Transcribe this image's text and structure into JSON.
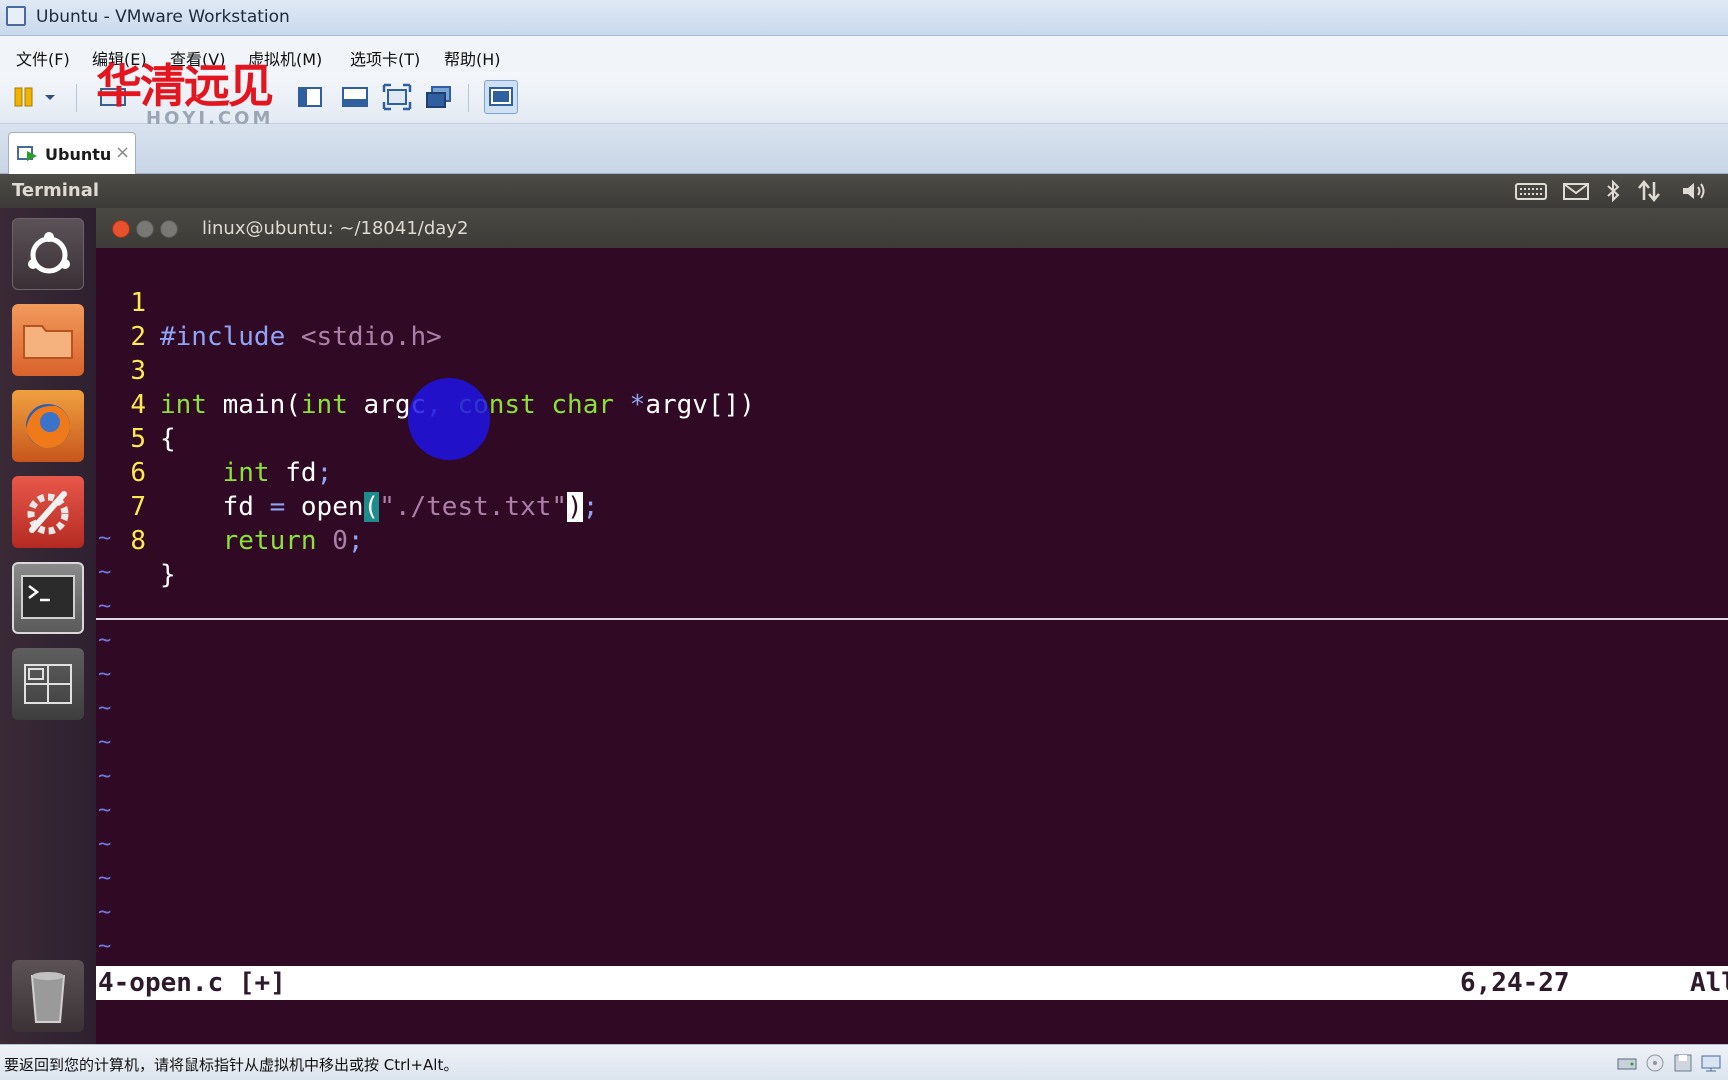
{
  "window": {
    "title": "Ubuntu - VMware Workstation"
  },
  "menu": [
    "文件(F)",
    "编辑(E)",
    "查看(V)",
    "虚拟机(M)",
    "选项卡(T)",
    "帮助(H)"
  ],
  "watermark": {
    "cn": "华清远见",
    "en": "HQYJ.COM"
  },
  "tab": {
    "label": "Ubuntu",
    "close": "×"
  },
  "panel": {
    "title": "Terminal"
  },
  "terminal": {
    "title": "linux@ubuntu: ~/18041/day2"
  },
  "editor": {
    "lines": [
      "1",
      "2",
      "3",
      "4",
      "5",
      "6",
      "7",
      "8"
    ],
    "tilde": "~",
    "code": {
      "l1_include": "#include",
      "l1_header": "<stdio.h>",
      "l3_int": "int",
      "l3_main": " main(",
      "l3_int2": "int",
      "l3_argc": " argc",
      "l3_comma": ",",
      "l3_const": "const",
      "l3_char": "char",
      "l3_star": "*",
      "l3_argv": "argv[])",
      "l4": "{",
      "l5_int": "int",
      "l5_fd": " fd",
      "l5_semi": ";",
      "l6_fd": "fd",
      "l6_eq": "=",
      "l6_open": "open",
      "l6_lparen": "(",
      "l6_str": "\"./test.txt\"",
      "l6_rparen": ")",
      "l6_semi": ";",
      "l7_return": "return",
      "l7_zero": "0",
      "l7_semi": ";",
      "l8": "}"
    }
  },
  "statusline": {
    "filename": "4-open.c [+]",
    "position": "6,24-27",
    "percent": "All"
  },
  "host_status": {
    "message": "要返回到您的计算机，请将鼠标指针从虚拟机中移出或按 Ctrl+Alt。"
  },
  "colors": {
    "terminal_bg": "#300a24",
    "line_number": "#fce94f",
    "type_keyword": "#8ae234",
    "string": "#ad7fa8",
    "watermark": "#e3161f"
  }
}
